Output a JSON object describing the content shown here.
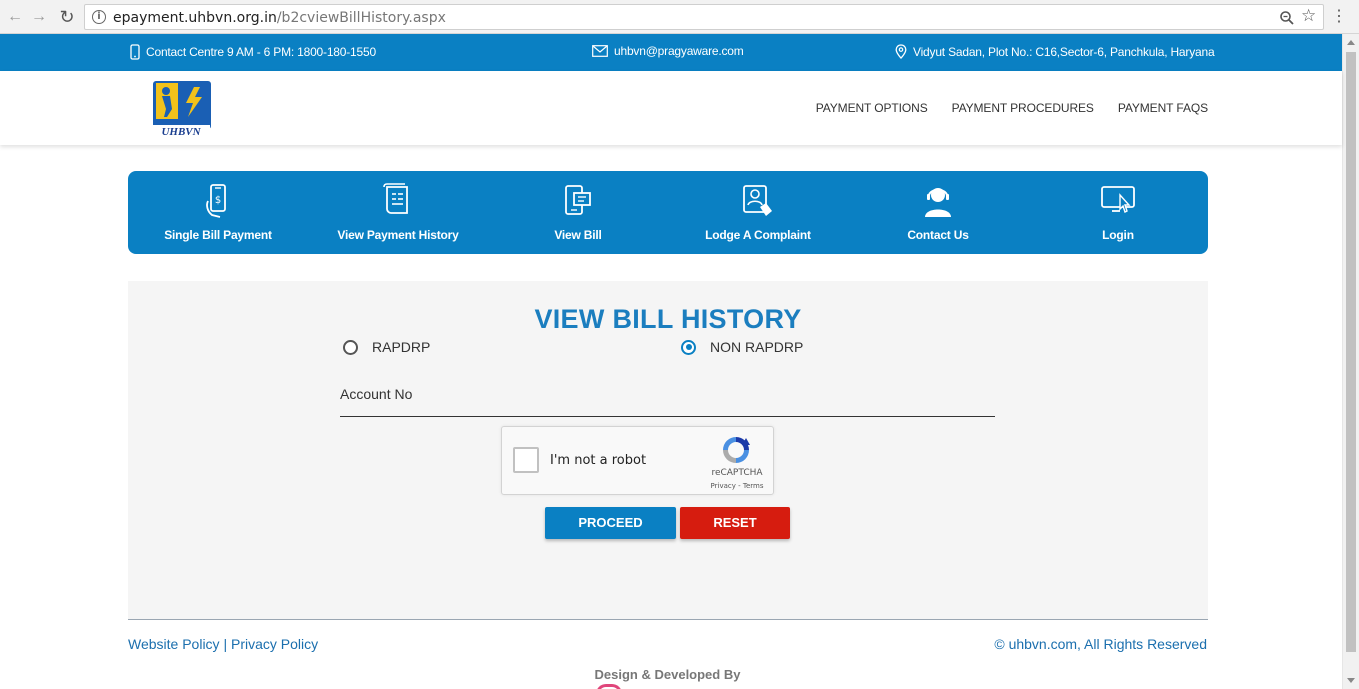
{
  "browser": {
    "url_host": "epayment.uhbvn.org.in",
    "url_path": "/b2cviewBillHistory.aspx"
  },
  "topbar": {
    "contact": "Contact Centre 9 AM - 6 PM: 1800-180-1550",
    "email": "uhbvn@pragyaware.com",
    "address": "Vidyut Sadan, Plot No.: C16,Sector-6, Panchkula, Haryana"
  },
  "header": {
    "logo_text": "UHBVN",
    "nav": [
      "PAYMENT OPTIONS",
      "PAYMENT PROCEDURES",
      "PAYMENT FAQS"
    ]
  },
  "services": [
    {
      "label": "Single Bill Payment",
      "icon": "mobile-payment-icon"
    },
    {
      "label": "View Payment History",
      "icon": "history-scroll-icon"
    },
    {
      "label": "View Bill",
      "icon": "view-bill-icon"
    },
    {
      "label": "Lodge A Complaint",
      "icon": "complaint-icon"
    },
    {
      "label": "Contact Us",
      "icon": "support-agent-icon"
    },
    {
      "label": "Login",
      "icon": "login-icon"
    }
  ],
  "form": {
    "heading": "VIEW BILL HISTORY",
    "radio_options": [
      {
        "label": "RAPDRP",
        "selected": false
      },
      {
        "label": "NON RAPDRP",
        "selected": true
      }
    ],
    "account_label": "Account No",
    "account_value": "",
    "recaptcha": {
      "label": "I'm not a robot",
      "brand": "reCAPTCHA",
      "links": "Privacy - Terms"
    },
    "proceed_label": "PROCEED",
    "reset_label": "RESET"
  },
  "footer": {
    "website_policy": "Website Policy",
    "separator": "|",
    "privacy_policy": "Privacy Policy",
    "copyright": "© uhbvn.com, All Rights Reserved",
    "designed_by": "Design & Developed By"
  },
  "colors": {
    "brand_blue": "#0a80c3",
    "heading_blue": "#1b7ebf",
    "reset_red": "#d61c0f",
    "panel_bg": "#f5f5f5"
  }
}
